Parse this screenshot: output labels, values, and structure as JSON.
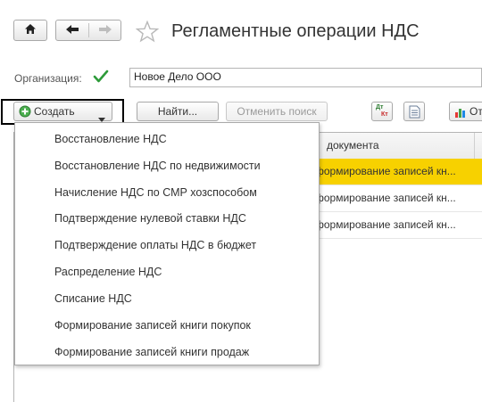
{
  "window": {
    "title": "Регламентные операции НДС"
  },
  "filter": {
    "label": "Организация:",
    "value": "Новое Дело ООО"
  },
  "toolbar": {
    "create_label": "Создать",
    "find_label": "Найти...",
    "cancel_search_label": "Отменить поиск",
    "dtkt_top": "Дт",
    "dtkt_bottom": "Кт",
    "report_label": "От"
  },
  "grid": {
    "column_header": "документа",
    "rows": [
      {
        "text": "формирование записей кн...",
        "selected": true
      },
      {
        "text": "формирование записей кн...",
        "selected": false
      },
      {
        "text": "формирование записей кн...",
        "selected": false
      }
    ]
  },
  "create_menu": {
    "items": [
      "Восстановление НДС",
      "Восстановление НДС по недвижимости",
      "Начисление НДС по СМР хозспособом",
      "Подтверждение нулевой ставки НДС",
      "Подтверждение оплаты НДС в бюджет",
      "Распределение НДС",
      "Списание НДС",
      "Формирование записей книги покупок",
      "Формирование записей книги продаж"
    ]
  },
  "colors": {
    "accent_green": "#4caf50",
    "selection_yellow": "#f7d100",
    "star_outline": "#b8b8b8"
  },
  "icons": [
    "home-icon",
    "arrow-left-icon",
    "arrow-right-icon",
    "star-icon",
    "checkmark-icon",
    "plus-circle-icon",
    "dropdown-arrow-icon",
    "dtkt-icon",
    "document-icon",
    "report-icon"
  ]
}
